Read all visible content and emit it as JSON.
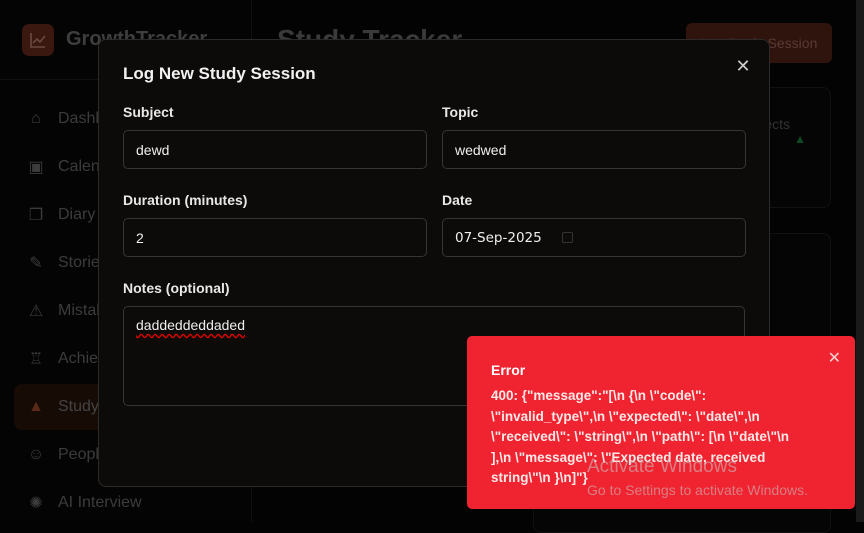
{
  "app": {
    "name": "GrowthTracker"
  },
  "sidebar": {
    "items": [
      {
        "label": "Dashboard",
        "icon": "home-icon"
      },
      {
        "label": "Calendar",
        "icon": "calendar-icon"
      },
      {
        "label": "Diary",
        "icon": "book-icon"
      },
      {
        "label": "Stories",
        "icon": "feather-icon"
      },
      {
        "label": "Mistakes",
        "icon": "warning-icon"
      },
      {
        "label": "Achievements",
        "icon": "trophy-icon"
      },
      {
        "label": "Study",
        "icon": "graduation-cap-icon",
        "active": true
      },
      {
        "label": "People",
        "icon": "users-icon"
      },
      {
        "label": "AI Interview",
        "icon": "brain-icon"
      }
    ]
  },
  "header": {
    "title": "Study Tracker",
    "button": "Log Study Session"
  },
  "card": {
    "label": "Subjects"
  },
  "modal": {
    "title": "Log New Study Session",
    "subject": {
      "label": "Subject",
      "value": "dewd"
    },
    "topic": {
      "label": "Topic",
      "value": "wedwed"
    },
    "duration": {
      "label": "Duration (minutes)",
      "value": "2"
    },
    "date": {
      "label": "Date",
      "value": "07-Sep-2025"
    },
    "notes": {
      "label": "Notes (optional)",
      "value": "daddeddeddaded"
    }
  },
  "toast": {
    "title": "Error",
    "message": "400: {\"message\":\"[\\n {\\n \\\"code\\\": \\\"invalid_type\\\",\\n \\\"expected\\\": \\\"date\\\",\\n \\\"received\\\": \\\"string\\\",\\n \\\"path\\\": [\\n \\\"date\\\"\\n ],\\n \\\"message\\\": \\\"Expected date, received string\\\"\\n }\\n]\"}"
  },
  "watermark": {
    "line1": "Activate Windows",
    "line2": "Go to Settings to activate Windows."
  },
  "colors": {
    "accent": "#c2410c",
    "error": "#f02330"
  }
}
